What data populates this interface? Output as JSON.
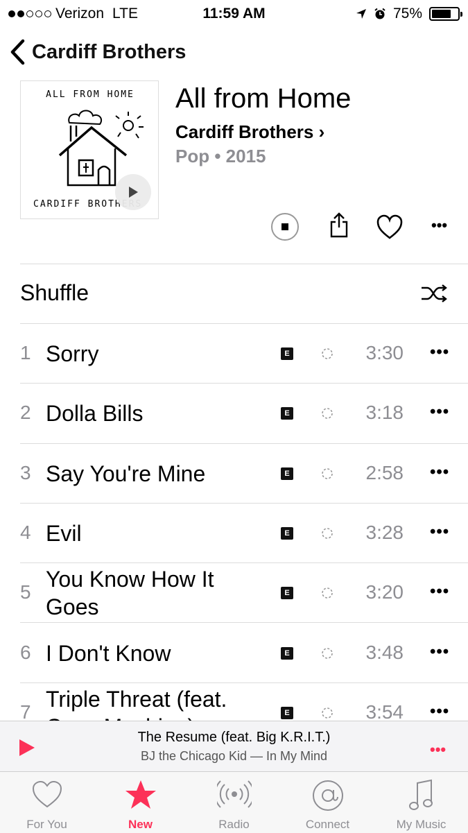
{
  "status_bar": {
    "carrier": "Verizon",
    "network": "LTE",
    "time": "11:59 AM",
    "battery": "75%"
  },
  "nav": {
    "back_label": "Cardiff Brothers"
  },
  "album": {
    "title": "All from Home",
    "artist": "Cardiff Brothers ›",
    "meta": "Pop • 2015",
    "art_title": "ALL FROM HOME",
    "art_bottom": "CARDIFF BROTHERS"
  },
  "shuffle": {
    "label": "Shuffle"
  },
  "tracks": [
    {
      "num": "1",
      "title": "Sorry",
      "explicit": "E",
      "duration": "3:30"
    },
    {
      "num": "2",
      "title": "Dolla Bills",
      "explicit": "E",
      "duration": "3:18"
    },
    {
      "num": "3",
      "title": "Say You're Mine",
      "explicit": "E",
      "duration": "2:58"
    },
    {
      "num": "4",
      "title": "Evil",
      "explicit": "E",
      "duration": "3:28"
    },
    {
      "num": "5",
      "title": "You Know How It Goes",
      "explicit": "E",
      "duration": "3:20"
    },
    {
      "num": "6",
      "title": "I Don't Know",
      "explicit": "E",
      "duration": "3:48"
    },
    {
      "num": "7",
      "title": "Triple Threat (feat. Casa Machine)",
      "explicit": "E",
      "duration": "3:54"
    }
  ],
  "more_glyph": "•••",
  "now_playing": {
    "title": "The Resume (feat. Big K.R.I.T.)",
    "subtitle": "BJ the Chicago Kid — In My Mind"
  },
  "tabs": [
    {
      "label": "For You",
      "icon": "heart-icon"
    },
    {
      "label": "New",
      "icon": "star-icon"
    },
    {
      "label": "Radio",
      "icon": "radio-icon"
    },
    {
      "label": "Connect",
      "icon": "at-icon"
    },
    {
      "label": "My Music",
      "icon": "music-note-icon"
    }
  ],
  "colors": {
    "accent": "#fc3158",
    "secondary_text": "#8e8e93"
  }
}
